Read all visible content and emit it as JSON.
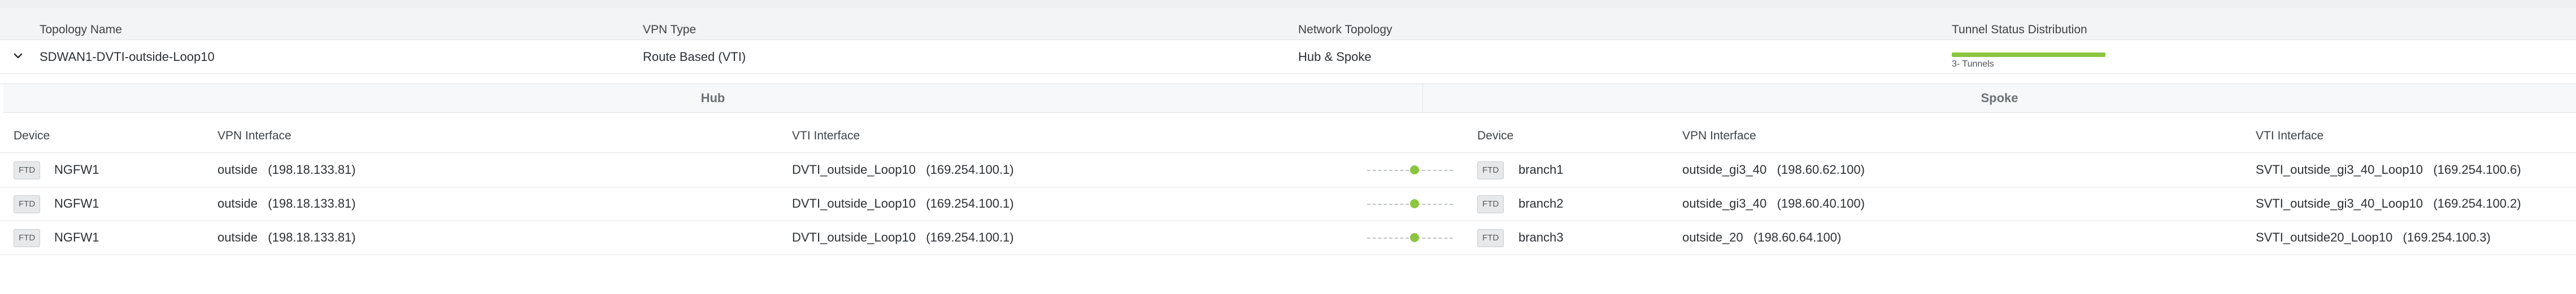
{
  "columns": {
    "topology_name": "Topology Name",
    "vpn_type": "VPN Type",
    "network_topology": "Network Topology",
    "tunnel_status": "Tunnel Status Distribution"
  },
  "topology": {
    "name": "SDWAN1-DVTI-outside-Loop10",
    "vpn_type": "Route Based (VTI)",
    "network_topology": "Hub & Spoke",
    "tunnel_label": "3- Tunnels",
    "tunnel_status_color": "#8cc63f",
    "expanded": true
  },
  "groups": {
    "hub": "Hub",
    "spoke": "Spoke"
  },
  "detail_columns": {
    "hub_device": "Device",
    "hub_vpn_interface": "VPN Interface",
    "hub_vti_interface": "VTI Interface",
    "spoke_device": "Device",
    "spoke_vpn_interface": "VPN Interface",
    "spoke_vti_interface": "VTI Interface"
  },
  "tunnels": [
    {
      "hub_badge": "FTD",
      "hub_device": "NGFW1",
      "hub_vpn_interface": "outside   (198.18.133.81)",
      "hub_vti_interface": "DVTI_outside_Loop10   (169.254.100.1)",
      "spoke_badge": "FTD",
      "spoke_device": "branch1",
      "spoke_vpn_interface": "outside_gi3_40   (198.60.62.100)",
      "spoke_vti_interface": "SVTI_outside_gi3_40_Loop10   (169.254.100.6)"
    },
    {
      "hub_badge": "FTD",
      "hub_device": "NGFW1",
      "hub_vpn_interface": "outside   (198.18.133.81)",
      "hub_vti_interface": "DVTI_outside_Loop10   (169.254.100.1)",
      "spoke_badge": "FTD",
      "spoke_device": "branch2",
      "spoke_vpn_interface": "outside_gi3_40   (198.60.40.100)",
      "spoke_vti_interface": "SVTI_outside_gi3_40_Loop10   (169.254.100.2)"
    },
    {
      "hub_badge": "FTD",
      "hub_device": "NGFW1",
      "hub_vpn_interface": "outside   (198.18.133.81)",
      "hub_vti_interface": "DVTI_outside_Loop10   (169.254.100.1)",
      "spoke_badge": "FTD",
      "spoke_device": "branch3",
      "spoke_vpn_interface": "outside_20   (198.60.64.100)",
      "spoke_vti_interface": "SVTI_outside20_Loop10   (169.254.100.3)"
    }
  ]
}
